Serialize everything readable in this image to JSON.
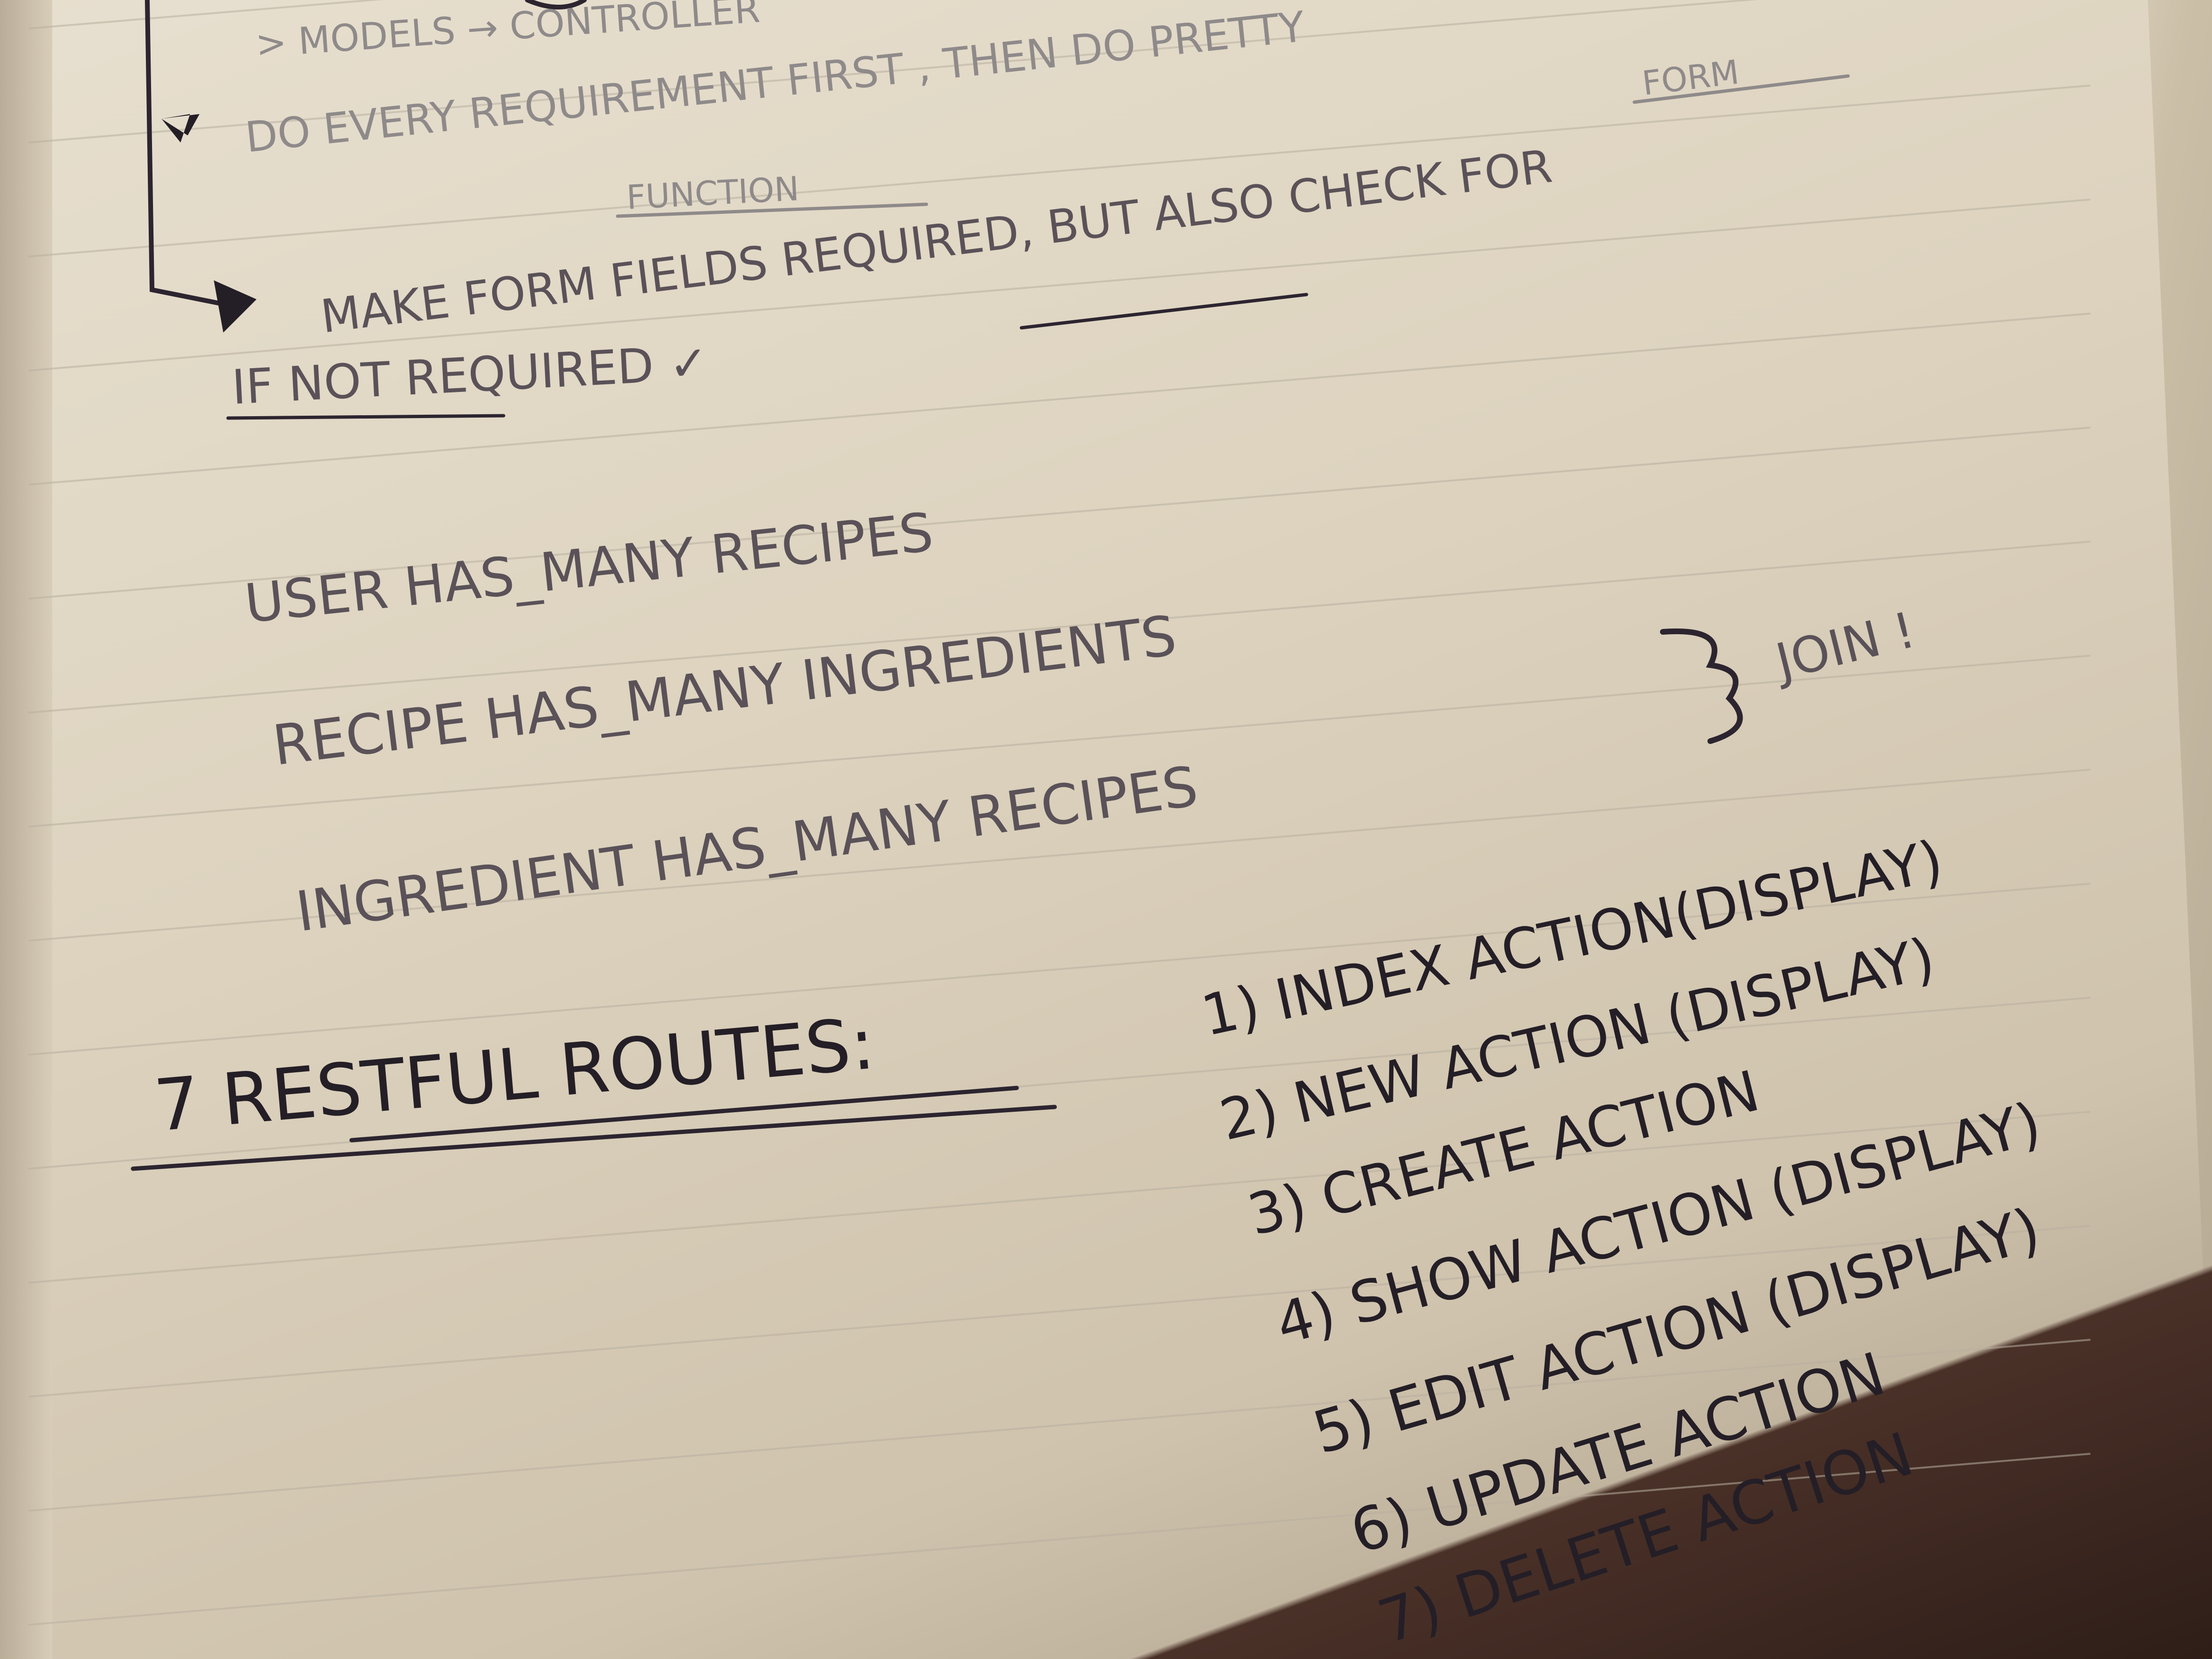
{
  "notes": {
    "line_models": "> MODELS  →  CONTROLLER",
    "line_do_every": "DO EVERY REQUIREMENT FIRST , THEN DO PRETTY",
    "line_form": "FORM",
    "line_function": "FUNCTION",
    "line_make_form": "MAKE FORM FIELDS REQUIRED, BUT ALSO CHECK FOR",
    "line_if_not": "IF NOT REQUIRED ✓"
  },
  "relations": {
    "user": "USER HAS_MANY RECIPES",
    "recipe": "RECIPE HAS_MANY INGREDIENTS",
    "ingredient": "INGREDIENT HAS_MANY RECIPES",
    "join": "JOIN !"
  },
  "routes": {
    "heading": "7 RESTFUL ROUTES:",
    "items": [
      "1) INDEX ACTION(display)",
      "2) NEW ACTION (display)",
      "3) CREATE ACTION",
      "4) SHOW ACTION (display)",
      "5) EDIT ACTION (display)",
      "6) UPDATE ACTION",
      "7) DELETE ACTION"
    ]
  }
}
